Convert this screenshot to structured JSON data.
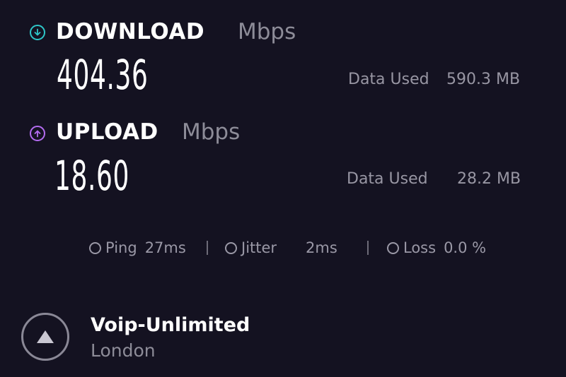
{
  "download": {
    "title": "DOWNLOAD",
    "unit": "Mbps",
    "value": "404.36",
    "data_used_label": "Data Used",
    "data_used_value": "590.3 MB",
    "icon": "download-arrow-icon",
    "color": "#2ec6c8"
  },
  "upload": {
    "title": "UPLOAD",
    "unit": "Mbps",
    "value": "18.60",
    "data_used_label": "Data Used",
    "data_used_value": "28.2 MB",
    "icon": "upload-arrow-icon",
    "color": "#b36cf0"
  },
  "stats": {
    "ping_label": "Ping",
    "ping_value": "27ms",
    "jitter_label": "Jitter",
    "jitter_value": "2ms",
    "loss_label": "Loss",
    "loss_value": "0.0 %"
  },
  "server": {
    "name": "Voip-Unlimited",
    "location": "London",
    "icon": "server-triangle-icon"
  }
}
